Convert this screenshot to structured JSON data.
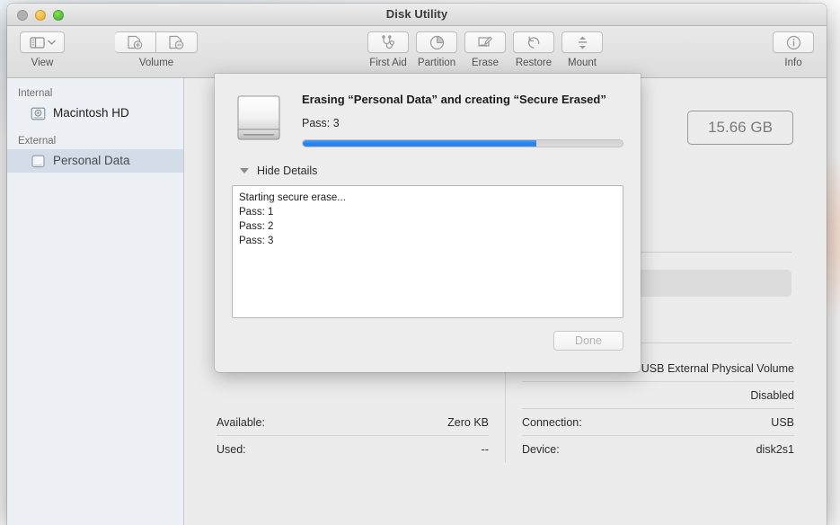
{
  "window": {
    "title": "Disk Utility",
    "traffic_lights": [
      "close",
      "minimize",
      "zoom"
    ]
  },
  "toolbar": {
    "groups": [
      {
        "label": "View",
        "icons": [
          "sidebar-icon",
          "chevron-down-icon"
        ]
      },
      {
        "label": "Volume",
        "icons": [
          "add-volume-icon",
          "remove-volume-icon"
        ]
      },
      {
        "label": "First Aid",
        "icons": [
          "stethoscope-icon"
        ]
      },
      {
        "label": "Partition",
        "icons": [
          "pie-chart-icon"
        ]
      },
      {
        "label": "Erase",
        "icons": [
          "erase-pencil-icon"
        ]
      },
      {
        "label": "Restore",
        "icons": [
          "undo-arrow-icon"
        ]
      },
      {
        "label": "Mount",
        "icons": [
          "eject-mount-icon"
        ]
      },
      {
        "label": "Info",
        "icons": [
          "info-circle-icon"
        ]
      }
    ]
  },
  "sidebar": {
    "sections": [
      {
        "header": "Internal",
        "items": [
          {
            "label": "Macintosh HD",
            "icon": "internal-disk-icon",
            "selected": false
          }
        ]
      },
      {
        "header": "External",
        "items": [
          {
            "label": "Personal Data",
            "icon": "external-disk-icon",
            "selected": true
          }
        ]
      }
    ]
  },
  "main": {
    "capacity_badge": "15.66 GB",
    "info_left": [
      {
        "key": "Available:",
        "value": "Zero KB"
      },
      {
        "key": "Used:",
        "value": "--"
      }
    ],
    "info_right": [
      {
        "key": "",
        "value": "USB External Physical Volume"
      },
      {
        "key": "",
        "value": "Disabled"
      },
      {
        "key": "Connection:",
        "value": "USB"
      },
      {
        "key": "Device:",
        "value": "disk2s1"
      }
    ]
  },
  "sheet": {
    "icon": "external-hard-drive-icon",
    "title": "Erasing “Personal Data” and creating “Secure Erased”",
    "subtitle": "Pass: 3",
    "progress_percent": 73,
    "progress_color": "#2a82ef",
    "details_toggle_label": "Hide Details",
    "log_lines": [
      "Starting secure erase...",
      "Pass: 1",
      "Pass: 2",
      "Pass: 3"
    ],
    "done_label": "Done",
    "done_enabled": false
  }
}
